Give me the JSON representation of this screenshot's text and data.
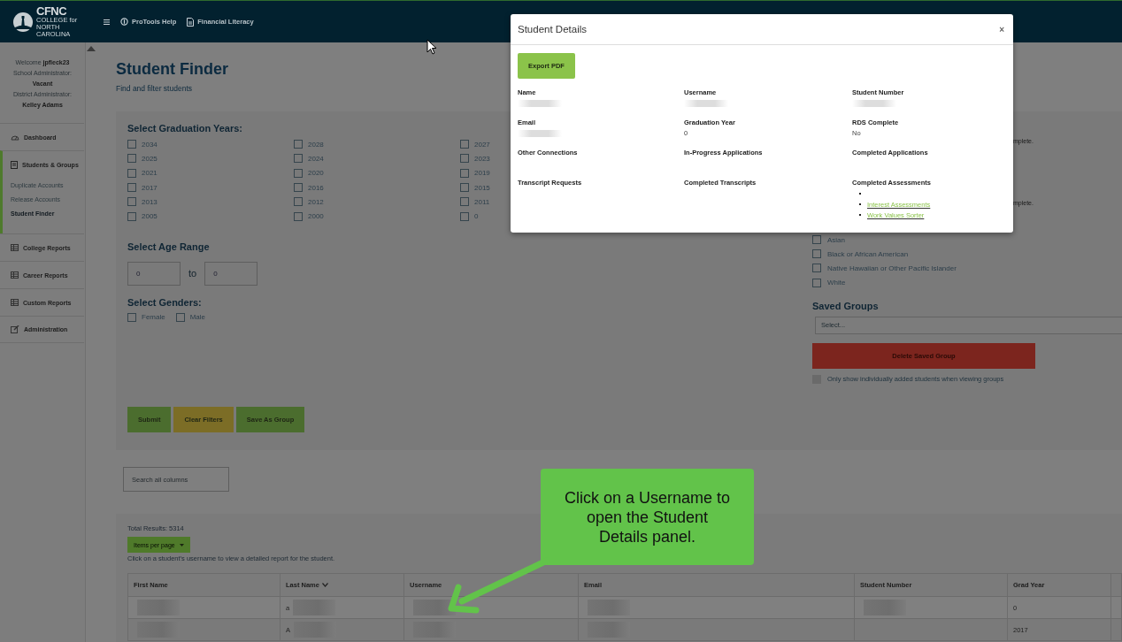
{
  "header": {
    "logo": {
      "title": "CFNC",
      "subtitle": "COLLEGE for NORTH CAROLINA"
    },
    "links": [
      {
        "label": "ProTools Help"
      },
      {
        "label": "Financial Literacy"
      }
    ]
  },
  "sidebar": {
    "user_lines": [
      {
        "kind": "text",
        "text": "Welcome **jpfleck23**"
      },
      {
        "kind": "text",
        "text": "School Administrator:"
      },
      {
        "kind": "name",
        "text": "Vacant"
      },
      {
        "kind": "text",
        "text": "District Administrator:"
      },
      {
        "kind": "name",
        "text": "Kelley Adams"
      }
    ],
    "items": [
      {
        "label": "Dashboard",
        "selected": false
      },
      {
        "label": "Students & Groups",
        "selected": true,
        "children": [
          {
            "label": "Duplicate Accounts",
            "selected": false
          },
          {
            "label": "Release Accounts",
            "selected": false
          },
          {
            "label": "Student Finder",
            "selected": true
          }
        ]
      },
      {
        "label": "College Reports",
        "selected": false
      },
      {
        "label": "Career Reports",
        "selected": false
      },
      {
        "label": "Custom Reports",
        "selected": false
      },
      {
        "label": "Administration",
        "selected": false
      }
    ]
  },
  "page": {
    "title": "Student Finder",
    "subtitle": "Find and filter students"
  },
  "filters": {
    "graduation_years": {
      "heading": "Select Graduation Years:",
      "options": [
        {
          "label": "2034",
          "checked": false
        },
        {
          "label": "2028",
          "checked": false
        },
        {
          "label": "2027",
          "checked": false
        },
        {
          "label": "2025",
          "checked": false
        },
        {
          "label": "2024",
          "checked": false
        },
        {
          "label": "2023",
          "checked": false
        },
        {
          "label": "2021",
          "checked": false
        },
        {
          "label": "2020",
          "checked": false
        },
        {
          "label": "2019",
          "checked": false
        },
        {
          "label": "2017",
          "checked": false
        },
        {
          "label": "2016",
          "checked": false
        },
        {
          "label": "2015",
          "checked": false
        },
        {
          "label": "2013",
          "checked": false
        },
        {
          "label": "2012",
          "checked": false
        },
        {
          "label": "2011",
          "checked": false
        },
        {
          "label": "2005",
          "checked": false
        },
        {
          "label": "2000",
          "checked": false
        },
        {
          "label": "0",
          "checked": false
        }
      ]
    },
    "age_range": {
      "heading": "Select Age Range",
      "from": "0",
      "separator": "to",
      "to": "0"
    },
    "genders": {
      "heading": "Select Genders:",
      "options": [
        {
          "label": "Female",
          "checked": false
        },
        {
          "label": "Male",
          "checked": false
        }
      ]
    },
    "partial_notes": [
      "mplete.",
      "mplete."
    ],
    "ethnicities": {
      "options": [
        {
          "label": "Asian",
          "checked": false
        },
        {
          "label": "Black or African American",
          "checked": false
        },
        {
          "label": "Native Hawaiian or Other Pacific Islander",
          "checked": false
        },
        {
          "label": "White",
          "checked": false
        }
      ]
    },
    "saved_groups": {
      "heading": "Saved Groups",
      "select_text": "Select...",
      "delete_button": "Delete Saved Group",
      "only_individual": {
        "label": "Only show individually added students when viewing groups",
        "checked": false,
        "disabled": true
      }
    },
    "buttons": [
      {
        "label": "Submit",
        "kind": "primary"
      },
      {
        "label": "Clear Filters",
        "kind": "warning"
      },
      {
        "label": "Save As Group",
        "kind": "primary"
      }
    ]
  },
  "search": {
    "placeholder": "Search all columns"
  },
  "results": {
    "total": "Total Results: 5314",
    "items_per_page": "Items per page",
    "hint": "Click on a student's username to view a detailed report for the student.",
    "columns": [
      {
        "label": "First Name",
        "sorted": false
      },
      {
        "label": "Last Name",
        "sorted": true
      },
      {
        "label": "Username",
        "sorted": false
      },
      {
        "label": "Email",
        "sorted": false
      },
      {
        "label": "Student Number",
        "sorted": false
      },
      {
        "label": "Grad Year",
        "sorted": false
      }
    ],
    "rows": [
      {
        "cells": [
          {
            "redacted": true
          },
          {
            "text": "a",
            "redacted": true
          },
          {
            "redacted": true
          },
          {
            "redacted": true
          },
          {
            "redacted": true
          },
          {
            "text": "0",
            "redacted": false
          }
        ]
      },
      {
        "cells": [
          {
            "redacted": true
          },
          {
            "text": "A",
            "redacted": true
          },
          {
            "redacted": true
          },
          {
            "redacted": true
          },
          {
            "redacted": false
          },
          {
            "text": "2017",
            "redacted": false
          }
        ]
      }
    ]
  },
  "modal": {
    "title": "Student Details",
    "close": "×",
    "export_button": "Export PDF",
    "fields": [
      {
        "label": "Name",
        "redacted": true
      },
      {
        "label": "Username",
        "redacted": true
      },
      {
        "label": "Student Number",
        "redacted": true
      },
      {
        "label": "Email",
        "redacted": true
      },
      {
        "label": "Graduation Year",
        "value": "0",
        "redacted": false
      },
      {
        "label": "RDS Complete",
        "value": "No",
        "redacted": false
      },
      {
        "label": "Other Connections",
        "redacted": false
      },
      {
        "label": "In-Progress Applications",
        "redacted": false
      },
      {
        "label": "Completed Applications",
        "redacted": false
      },
      {
        "label": "Transcript Requests",
        "redacted": false
      },
      {
        "label": "Completed Transcripts",
        "redacted": false
      },
      {
        "label": "Completed Assessments",
        "redacted": false,
        "list": [
          {
            "kind": "empty"
          },
          {
            "kind": "link",
            "text": "Interest Assessments"
          },
          {
            "kind": "link",
            "text": "Work Values Sorter"
          }
        ]
      }
    ]
  },
  "callout": {
    "text": "Click on a Username to open the Student Details panel."
  }
}
